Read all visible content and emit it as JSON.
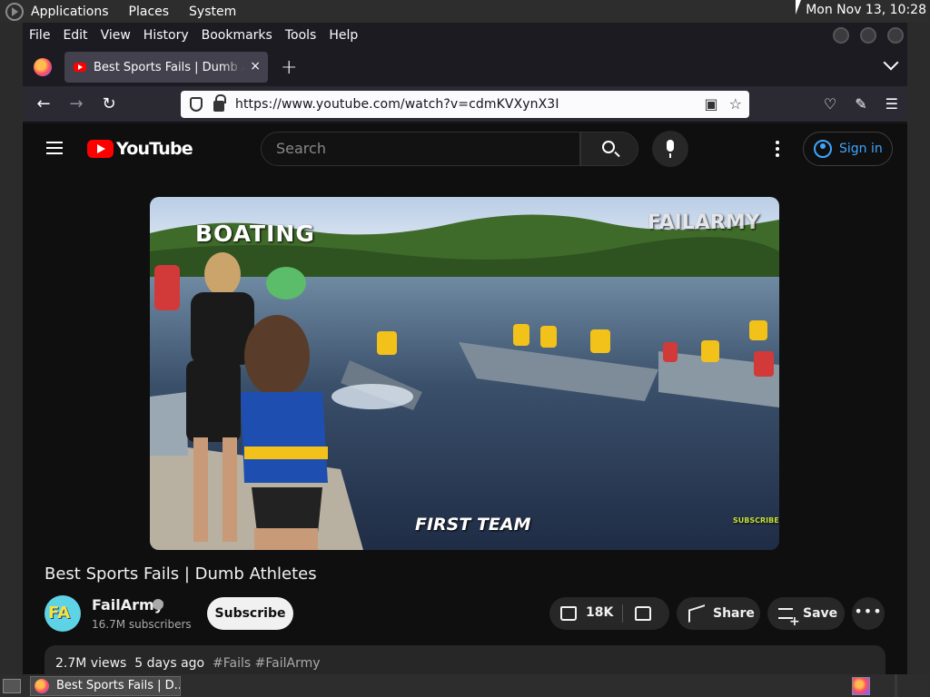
{
  "top_panel": {
    "menus": [
      "Applications",
      "Places",
      "System"
    ],
    "clock": "Mon Nov 13, 10:28"
  },
  "firefox": {
    "menubar": [
      "File",
      "Edit",
      "View",
      "History",
      "Bookmarks",
      "Tools",
      "Help"
    ],
    "tab": {
      "title": "Best Sports Fails | Dumb Athletes",
      "close": "×"
    },
    "new_tab": "+",
    "url": "https://www.youtube.com/watch?v=cdmKVXynX3I"
  },
  "youtube": {
    "logo_text": "YouTube",
    "search_placeholder": "Search",
    "sign_in": "Sign in",
    "video_overlay": {
      "top_left": "BOATING",
      "watermark": "FAILARMY",
      "caption": "FIRST TEAM",
      "subscribe_badge": "SUBSCRIBE"
    },
    "video_title": "Best Sports Fails | Dumb Athletes",
    "channel": {
      "name": "FailArmy",
      "avatar_text": "FA",
      "subscribers": "16.7M subscribers"
    },
    "subscribe_label": "Subscribe",
    "like_count": "18K",
    "share_label": "Share",
    "save_label": "Save",
    "more_label": "•••",
    "description": {
      "views": "2.7M views",
      "date": "5 days ago",
      "tags": "#Fails #FailArmy"
    }
  },
  "bottom_panel": {
    "task_title": "Best Sports Fails | D..."
  },
  "colors": {
    "yt_red": "#ff0000",
    "signin_blue": "#3ea6ff",
    "page_bg": "#0f0f0f"
  }
}
